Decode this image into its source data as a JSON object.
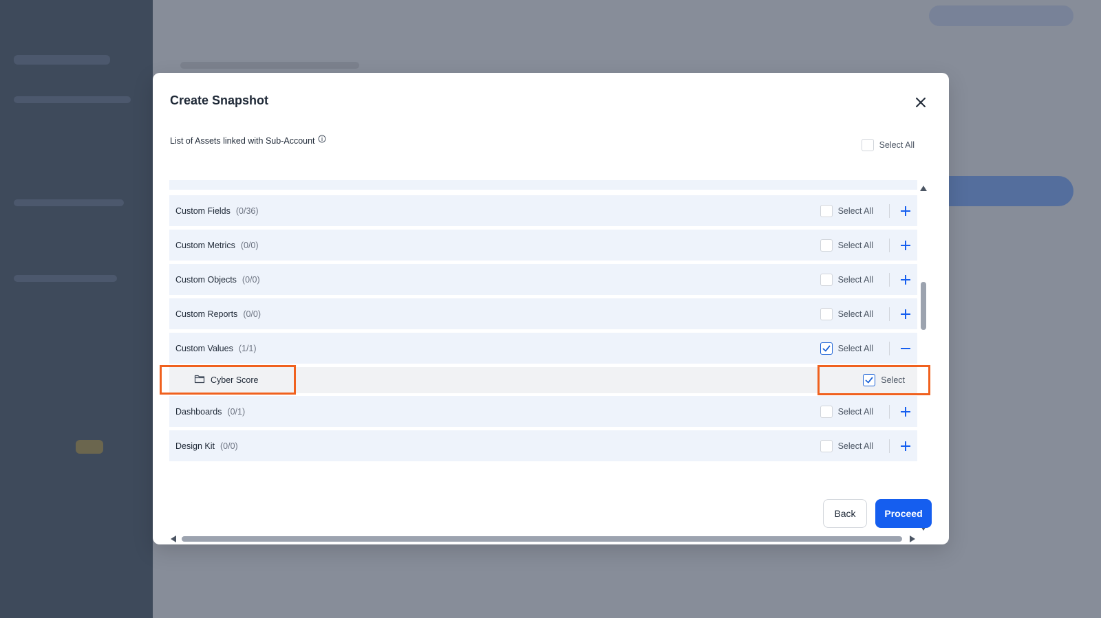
{
  "modal": {
    "title": "Create Snapshot",
    "assets_label": "List of Assets linked with Sub-Account",
    "select_all_label": "Select All"
  },
  "rows": [
    {
      "name": "Custom Fields",
      "count": "(0/36)",
      "select_label": "Select All",
      "checked": false,
      "expanded": false
    },
    {
      "name": "Custom Metrics",
      "count": "(0/0)",
      "select_label": "Select All",
      "checked": false,
      "expanded": false
    },
    {
      "name": "Custom Objects",
      "count": "(0/0)",
      "select_label": "Select All",
      "checked": false,
      "expanded": false
    },
    {
      "name": "Custom Reports",
      "count": "(0/0)",
      "select_label": "Select All",
      "checked": false,
      "expanded": false
    },
    {
      "name": "Custom Values",
      "count": "(1/1)",
      "select_label": "Select All",
      "checked": true,
      "expanded": true
    },
    {
      "name": "Dashboards",
      "count": "(0/1)",
      "select_label": "Select All",
      "checked": false,
      "expanded": false
    },
    {
      "name": "Design Kit",
      "count": "(0/0)",
      "select_label": "Select All",
      "checked": false,
      "expanded": false
    }
  ],
  "subitem": {
    "name": "Cyber Score",
    "select_label": "Select",
    "checked": true,
    "icon": "folder-icon"
  },
  "footer": {
    "back_label": "Back",
    "proceed_label": "Proceed"
  },
  "colors": {
    "accent": "#155eef",
    "highlight": "#f0611e",
    "row_bg": "#eef3fb"
  }
}
